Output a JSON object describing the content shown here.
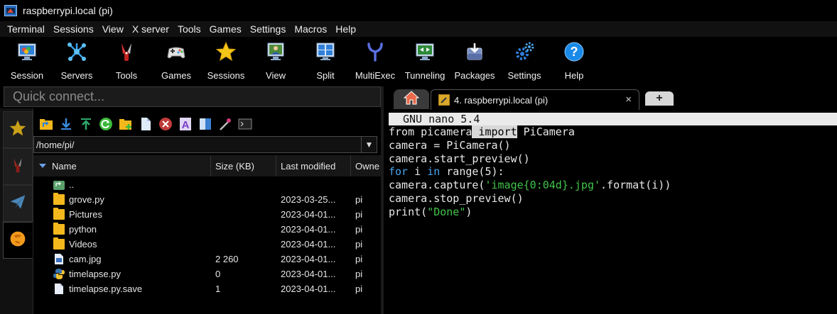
{
  "window": {
    "title": "raspberrypi.local (pi)"
  },
  "menu": [
    "Terminal",
    "Sessions",
    "View",
    "X server",
    "Tools",
    "Games",
    "Settings",
    "Macros",
    "Help"
  ],
  "toolbar": [
    {
      "label": "Session",
      "icon": "session-icon"
    },
    {
      "label": "Servers",
      "icon": "servers-icon"
    },
    {
      "label": "Tools",
      "icon": "tools-icon"
    },
    {
      "label": "Games",
      "icon": "games-icon"
    },
    {
      "label": "Sessions",
      "icon": "sessions-star-icon"
    },
    {
      "label": "View",
      "icon": "view-icon"
    },
    {
      "label": "Split",
      "icon": "split-icon"
    },
    {
      "label": "MultiExec",
      "icon": "multiexec-icon"
    },
    {
      "label": "Tunneling",
      "icon": "tunneling-icon"
    },
    {
      "label": "Packages",
      "icon": "packages-icon"
    },
    {
      "label": "Settings",
      "icon": "settings-icon"
    },
    {
      "label": "Help",
      "icon": "help-icon"
    }
  ],
  "quick_connect": {
    "placeholder": "Quick connect..."
  },
  "sftp": {
    "path": "/home/pi/",
    "columns": {
      "name": "Name",
      "size": "Size (KB)",
      "modified": "Last modified",
      "owner": "Owne"
    },
    "files": [
      {
        "name": "..",
        "size": "",
        "modified": "",
        "owner": "",
        "type": "parent"
      },
      {
        "name": "grove.py",
        "size": "",
        "modified": "2023-03-25...",
        "owner": "pi",
        "type": "folder"
      },
      {
        "name": "Pictures",
        "size": "",
        "modified": "2023-04-01...",
        "owner": "pi",
        "type": "folder"
      },
      {
        "name": "python",
        "size": "",
        "modified": "2023-04-01...",
        "owner": "pi",
        "type": "folder"
      },
      {
        "name": "Videos",
        "size": "",
        "modified": "2023-04-01...",
        "owner": "pi",
        "type": "folder"
      },
      {
        "name": "cam.jpg",
        "size": "2 260",
        "modified": "2023-04-01...",
        "owner": "pi",
        "type": "image"
      },
      {
        "name": "timelapse.py",
        "size": "0",
        "modified": "2023-04-01...",
        "owner": "pi",
        "type": "python"
      },
      {
        "name": "timelapse.py.save",
        "size": "1",
        "modified": "2023-04-01...",
        "owner": "pi",
        "type": "file"
      }
    ]
  },
  "terminal": {
    "tab_title": "4. raspberrypi.local (pi)",
    "close_symbol": "×",
    "plus_symbol": "+",
    "nano_header": "GNU nano 5.4",
    "code": {
      "l1a": "from picamera",
      "l1b": " import",
      "l1c": " PiCamera",
      "l2": "camera = PiCamera()",
      "l3": "camera.start_preview()",
      "l4a": "for",
      "l4b": " i ",
      "l4c": "in",
      "l4d": " range(5):",
      "l5a": "camera.capture(",
      "l5b": "'image{0:04d}.jpg'",
      "l5c": ".format(i))",
      "l6": "camera.stop_preview()",
      "l7a": "print(",
      "l7b": "\"Done\"",
      "l7c": ")"
    }
  },
  "colors": {
    "accent_blue": "#4aa3e8",
    "string_green": "#41c34a",
    "folder_yellow": "#f3b81c"
  }
}
